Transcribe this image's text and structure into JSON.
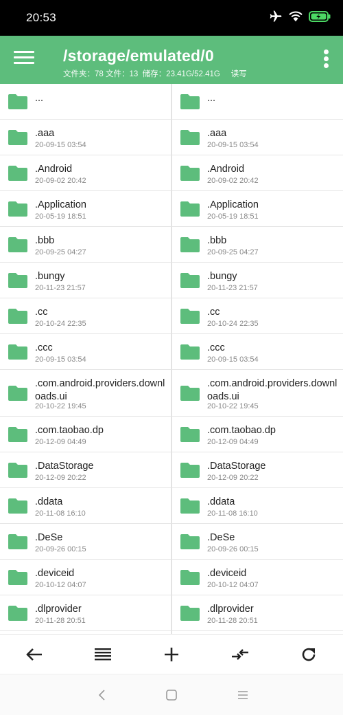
{
  "status": {
    "time": "20:53"
  },
  "appbar": {
    "title": "/storage/emulated/0",
    "subtitle": "文件夹：78 文件：13  储存：23.41G/52.41G     读写"
  },
  "left_pane": {
    "items": [
      {
        "name": "...",
        "date": ""
      },
      {
        "name": ".aaa",
        "date": "20-09-15 03:54"
      },
      {
        "name": ".Android",
        "date": "20-09-02 20:42"
      },
      {
        "name": ".Application",
        "date": "20-05-19 18:51"
      },
      {
        "name": ".bbb",
        "date": "20-09-25 04:27"
      },
      {
        "name": ".bungy",
        "date": "20-11-23 21:57"
      },
      {
        "name": ".cc",
        "date": "20-10-24 22:35"
      },
      {
        "name": ".ccc",
        "date": "20-09-15 03:54"
      },
      {
        "name": ".com.android.providers.downloads.ui",
        "date": "20-10-22 19:45"
      },
      {
        "name": ".com.taobao.dp",
        "date": "20-12-09 04:49"
      },
      {
        "name": ".DataStorage",
        "date": "20-12-09 20:22"
      },
      {
        "name": ".ddata",
        "date": "20-11-08 16:10"
      },
      {
        "name": ".DeSe",
        "date": "20-09-26 00:15"
      },
      {
        "name": ".deviceid",
        "date": "20-10-12 04:07"
      },
      {
        "name": ".dlprovider",
        "date": "20-11-28 20:51"
      }
    ]
  },
  "right_pane": {
    "items": [
      {
        "name": "...",
        "date": ""
      },
      {
        "name": ".aaa",
        "date": "20-09-15 03:54"
      },
      {
        "name": ".Android",
        "date": "20-09-02 20:42"
      },
      {
        "name": ".Application",
        "date": "20-05-19 18:51"
      },
      {
        "name": ".bbb",
        "date": "20-09-25 04:27"
      },
      {
        "name": ".bungy",
        "date": "20-11-23 21:57"
      },
      {
        "name": ".cc",
        "date": "20-10-24 22:35"
      },
      {
        "name": ".ccc",
        "date": "20-09-15 03:54"
      },
      {
        "name": ".com.android.providers.downloads.ui",
        "date": "20-10-22 19:45"
      },
      {
        "name": ".com.taobao.dp",
        "date": "20-12-09 04:49"
      },
      {
        "name": ".DataStorage",
        "date": "20-12-09 20:22"
      },
      {
        "name": ".ddata",
        "date": "20-11-08 16:10"
      },
      {
        "name": ".DeSe",
        "date": "20-09-26 00:15"
      },
      {
        "name": ".deviceid",
        "date": "20-10-12 04:07"
      },
      {
        "name": ".dlprovider",
        "date": "20-11-28 20:51"
      }
    ]
  },
  "toolbar": {
    "icons": [
      "back-arrow-icon",
      "list-view-icon",
      "add-icon",
      "swap-icon",
      "refresh-icon"
    ]
  },
  "navbar": {
    "icons": [
      "nav-back-icon",
      "nav-home-icon",
      "nav-recents-icon"
    ]
  },
  "colors": {
    "accent": "#5dbd7c",
    "folder": "#5dbd7c",
    "status_bar": "#000000",
    "battery": "#4cd964"
  }
}
